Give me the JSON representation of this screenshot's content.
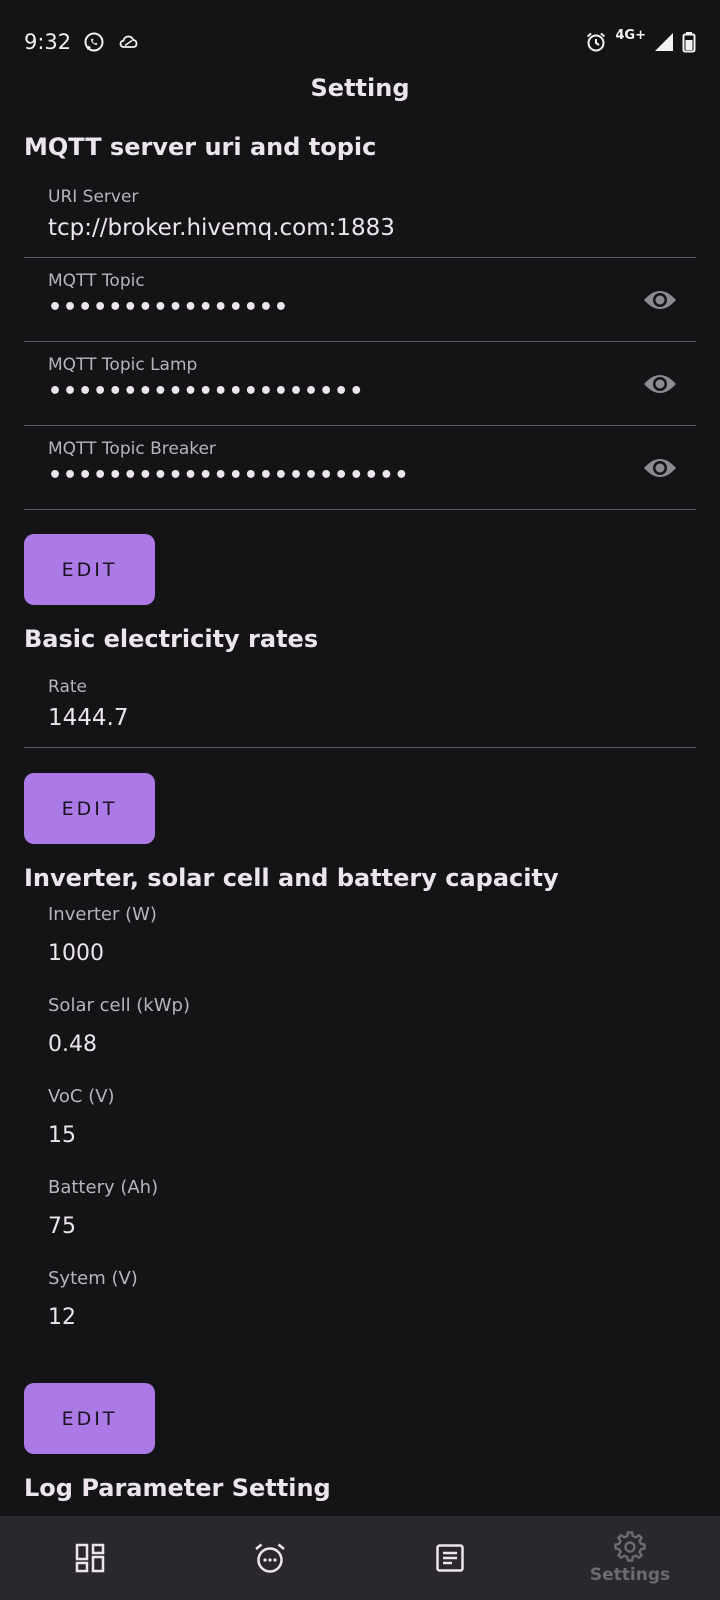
{
  "status_bar": {
    "time": "9:32",
    "network": "4G+",
    "icons": [
      "whatsapp-icon",
      "cloud-icon",
      "alarm-icon",
      "signal-icon",
      "battery-icon"
    ]
  },
  "app": {
    "title": "Setting"
  },
  "mqtt": {
    "title": "MQTT server uri and topic",
    "fields": [
      {
        "label": "URI Server",
        "value": "tcp://broker.hivemq.com:1883"
      },
      {
        "label": "MQTT Topic",
        "value": "••••••••••••••••"
      },
      {
        "label": "MQTT Topic Lamp",
        "value": "•••••••••••••••••••••"
      },
      {
        "label": "MQTT Topic Breaker",
        "value": "••••••••••••••••••••••••"
      }
    ],
    "edit_label": "EDIT"
  },
  "rates": {
    "title": "Basic electricity rates",
    "rate_label": "Rate",
    "rate_value": "1444.7",
    "edit_label": "EDIT"
  },
  "capacity": {
    "title": "Inverter, solar cell and battery capacity",
    "items": [
      {
        "label": "Inverter (W)",
        "value": "1000"
      },
      {
        "label": "Solar cell (kWp)",
        "value": "0.48"
      },
      {
        "label": "VoC (V)",
        "value": "15"
      },
      {
        "label": "Battery (Ah)",
        "value": "75"
      },
      {
        "label": "Sytem (V)",
        "value": "12"
      }
    ],
    "edit_label": "EDIT"
  },
  "log": {
    "title": "Log Parameter Setting"
  },
  "bottom_nav": {
    "items": [
      {
        "icon": "dashboard-icon"
      },
      {
        "icon": "alarm-clock-icon"
      },
      {
        "icon": "document-icon"
      },
      {
        "icon": "gear-icon",
        "label": "Settings"
      }
    ],
    "accent": "#AC7AE6"
  }
}
